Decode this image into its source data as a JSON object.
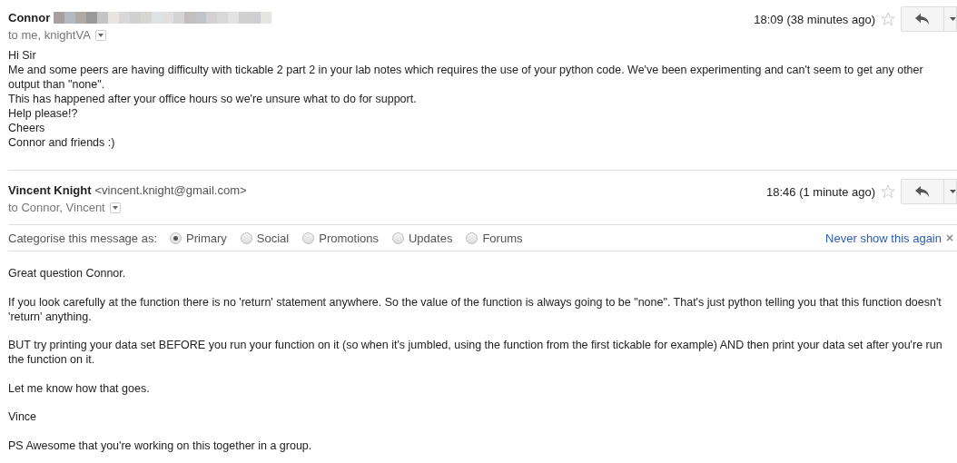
{
  "messages": [
    {
      "sender": "Connor",
      "sender_email_redacted": true,
      "recipients": "to me, knightVA",
      "time": "18:09 (38 minutes ago)",
      "starred": false,
      "body": [
        [
          "Hi Sir",
          "Me and some peers are having difficulty with tickable 2 part 2 in your lab notes which requires the use of your python code. We've been experimenting and can't seem to get any other output than \"none\".",
          "This has happened after your office hours so we're unsure what to do for support.",
          "Help please!?",
          "Cheers",
          "Connor and friends :)"
        ]
      ]
    },
    {
      "sender": "Vincent Knight",
      "sender_email": "<vincent.knight@gmail.com>",
      "recipients": "to Connor, Vincent",
      "time": "18:46 (1 minute ago)",
      "starred": false,
      "categorise": {
        "label": "Categorise this message as:",
        "options": [
          {
            "label": "Primary",
            "selected": true
          },
          {
            "label": "Social",
            "selected": false
          },
          {
            "label": "Promotions",
            "selected": false
          },
          {
            "label": "Updates",
            "selected": false
          },
          {
            "label": "Forums",
            "selected": false
          }
        ],
        "dismiss": "Never show this again"
      },
      "body": [
        [
          "Great question Connor."
        ],
        [
          "If you look carefully at the function there is no 'return' statement anywhere. So the value of the function is always going to be \"none\". That's just python telling you that this function doesn't 'return' anything."
        ],
        [
          "BUT try printing your data set BEFORE you run your function on it (so when it's jumbled, using the function from the first tickable for example) AND then print your data set after you're run the function on it."
        ],
        [
          "Let me know how that goes."
        ],
        [
          "Vince"
        ],
        [
          "PS Awesome that you're working on this together in a group."
        ]
      ]
    }
  ]
}
